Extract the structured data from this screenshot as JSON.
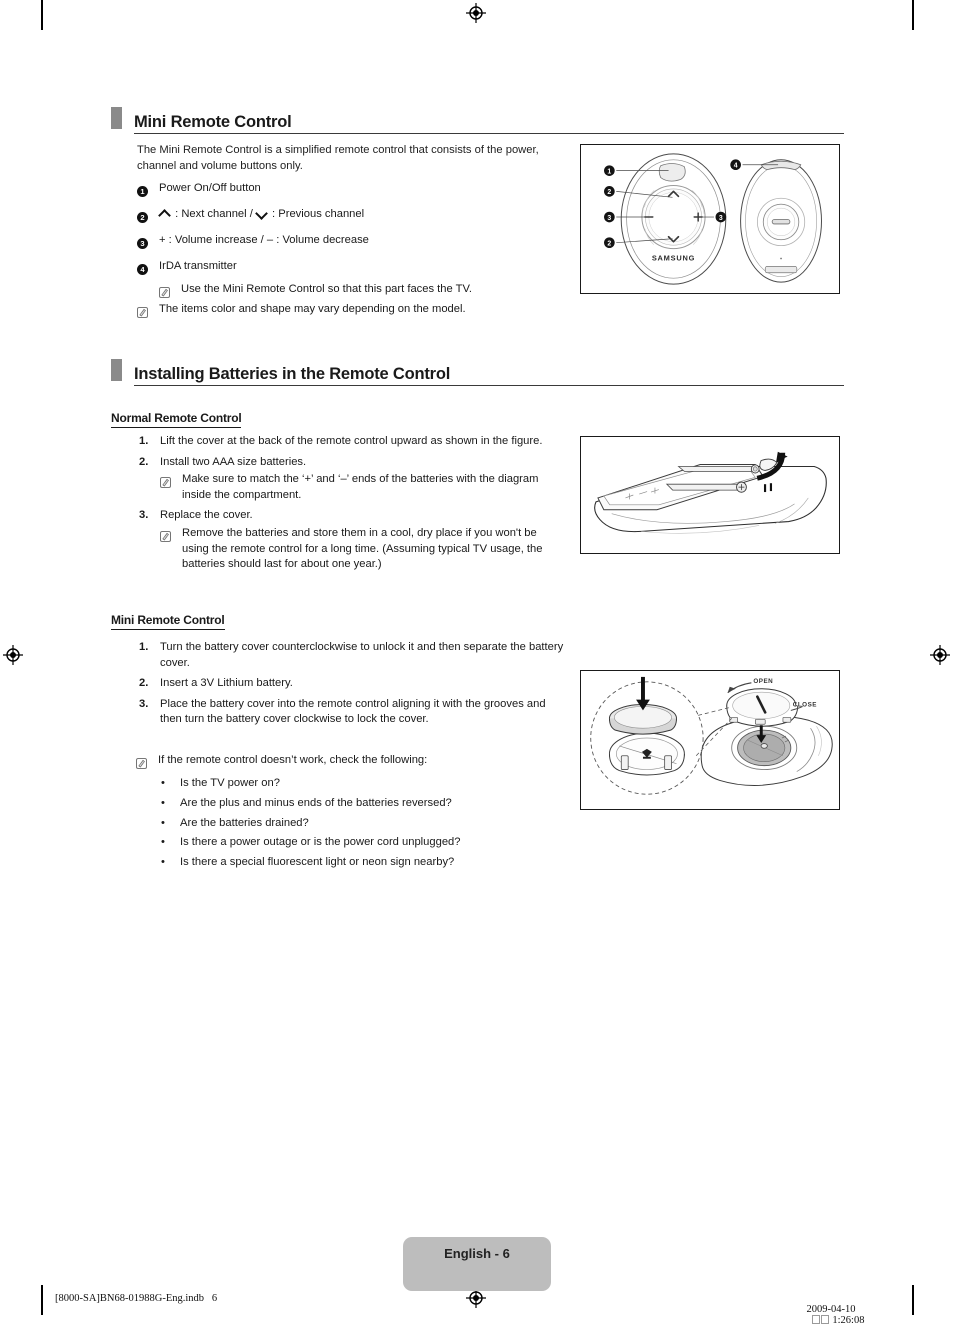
{
  "document": {
    "page_label": "English - 6",
    "footer_left": "[8000-SA]BN68-01988G-Eng.indb   6",
    "footer_date": "2009-04-10",
    "footer_time": "1:26:08"
  },
  "colors": {
    "section_block": "#8a8a8a",
    "page_badge": "#bdbdbd",
    "text": "#1a1a1a",
    "rule": "#3a3a3a"
  },
  "sections": [
    {
      "id": "mini-remote-control",
      "title": "Mini Remote Control",
      "intro": "The Mini Remote Control is a simplified remote control that consists of the power, channel and volume buttons only.",
      "numbered_items": [
        {
          "num": "1",
          "text": "Power On/Off button"
        },
        {
          "num": "2",
          "text_prefix": "",
          "text": " : Next channel / ",
          "text_suffix": " : Previous channel"
        },
        {
          "num": "3",
          "text": "+ : Volume increase / – : Volume decrease"
        },
        {
          "num": "4",
          "text": "IrDA transmitter"
        }
      ],
      "item4_note": "Use the Mini Remote Control so that this part faces the TV.",
      "footer_note": "The items color and shape may vary depending on the model."
    },
    {
      "id": "installing-batteries",
      "title": "Installing Batteries in the Remote Control",
      "sub_sections": [
        {
          "id": "normal-remote-control",
          "heading": "Normal Remote Control",
          "steps": [
            {
              "num": "1.",
              "text": "Lift the cover at the back of the remote control upward as shown in the figure.",
              "note": null
            },
            {
              "num": "2.",
              "text": "Install two AAA size batteries.",
              "note": "Make sure to match the ‘+’ and ‘–’ ends of the batteries with the diagram inside the compartment."
            },
            {
              "num": "3.",
              "text": "Replace the cover.",
              "note": "Remove the batteries and store them in a cool, dry place if you won't be using the remote control for a long time. (Assuming typical TV usage, the batteries should last for about one year.)"
            }
          ]
        },
        {
          "id": "mini-remote-control-batteries",
          "heading": "Mini Remote Control",
          "steps": [
            {
              "num": "1.",
              "text": "Turn the battery cover counterclockwise to unlock it and then separate the battery cover.",
              "note": null
            },
            {
              "num": "2.",
              "text": "Insert a 3V Lithium battery.",
              "note": null
            },
            {
              "num": "3.",
              "text": "Place the battery cover into the remote control aligning it with the grooves and then turn the battery cover clockwise to lock the cover.",
              "note": null
            }
          ],
          "troubleshoot_intro": "If the remote control doesn’t work, check the following:",
          "troubleshoot_items": [
            "Is the TV power on?",
            "Are the plus and minus ends of the batteries reversed?",
            "Are the batteries drained?",
            "Is there a power outage or is the power cord unplugged?",
            "Is there a special fluorescent light or neon sign nearby?"
          ]
        }
      ]
    }
  ],
  "figures": {
    "mini_remote": {
      "brand_label": "SAMSUNG",
      "callouts": [
        "1",
        "2",
        "3",
        "2",
        "3",
        "4"
      ],
      "plus_label": "+"
    },
    "normal_remote_battery": {
      "plus_label": "+"
    },
    "mini_remote_battery": {
      "open_label": "OPEN",
      "close_label": "CLOSE"
    }
  }
}
